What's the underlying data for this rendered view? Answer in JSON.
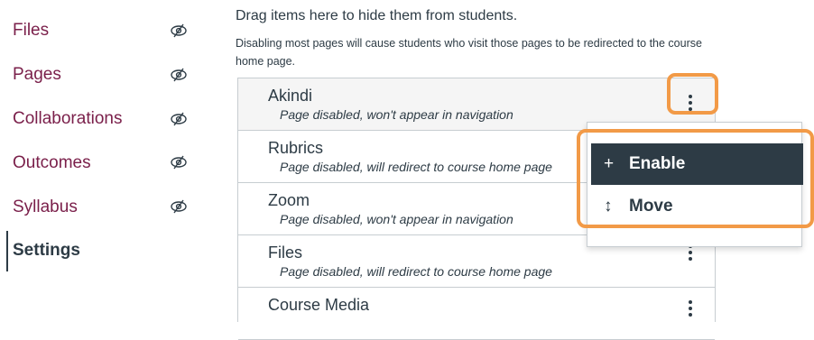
{
  "sidebar": {
    "items": [
      {
        "label": "Files",
        "icon": "eye-slash-icon"
      },
      {
        "label": "Pages",
        "icon": "eye-slash-icon"
      },
      {
        "label": "Collaborations",
        "icon": "eye-slash-icon"
      },
      {
        "label": "Outcomes",
        "icon": "eye-slash-icon"
      },
      {
        "label": "Syllabus",
        "icon": "eye-slash-icon"
      }
    ],
    "active_label": "Settings"
  },
  "hidden_section": {
    "title": "Drag items here to hide them from students.",
    "description": "Disabling most pages will cause students who visit those pages to be redirected to the course home page."
  },
  "list": [
    {
      "name": "Akindi",
      "status": "Page disabled, won't appear in navigation"
    },
    {
      "name": "Rubrics",
      "status": "Page disabled, will redirect to course home page"
    },
    {
      "name": "Zoom",
      "status": "Page disabled, won't appear in navigation"
    },
    {
      "name": "Files",
      "status": "Page disabled, will redirect to course home page"
    },
    {
      "name": "Course Media",
      "status": ""
    }
  ],
  "menu": {
    "enable_label": "Enable",
    "enable_glyph": "+",
    "move_label": "Move",
    "move_glyph": "↕"
  },
  "colors": {
    "nav_link": "#7a1f4a",
    "text": "#2d3b45",
    "highlight": "#f29a47",
    "menu_active_bg": "#2d3b45"
  }
}
